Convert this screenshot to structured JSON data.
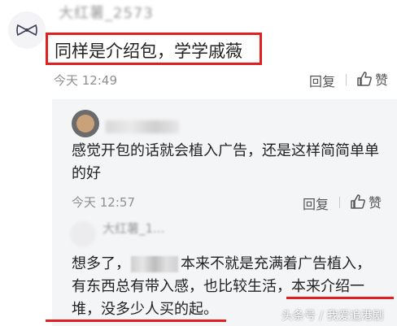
{
  "top_comment": {
    "username": "大红薯_2573",
    "text": "同样是介绍包，学学戚薇",
    "time": "今天 12:49",
    "reply_label": "回复",
    "like_label": "赞",
    "highlight_color": "#e02020"
  },
  "reply_1": {
    "text": "感觉开包的话就会植入广告，还是这样简简单单的好",
    "time": "今天 12:57",
    "reply_label": "回复",
    "like_label": "赞"
  },
  "reply_2": {
    "username": "大红薯_1...",
    "seg1": "想多了，",
    "seg2": "本来不就是充满着广告植入，",
    "line2_a": "有东西总有带入感，也比较生活，",
    "line2_b": "本来介绍一",
    "line3": "堆，没多少人买的起。"
  },
  "watermark": "头条号 / 我爱追港剧",
  "icons": [
    "bow-icon",
    "thumbs-up-icon"
  ]
}
